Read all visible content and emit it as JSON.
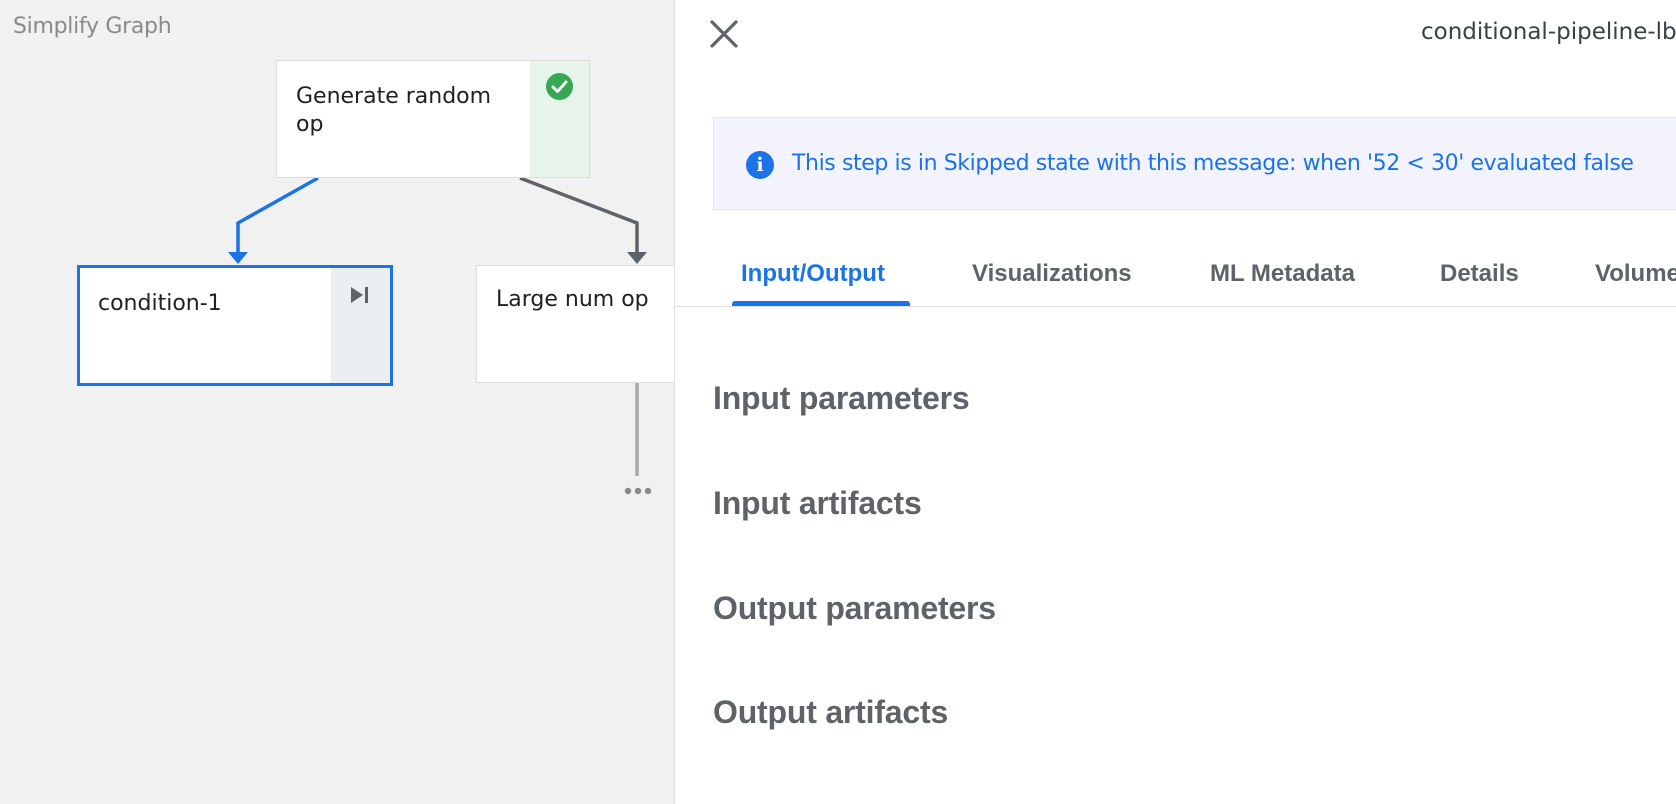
{
  "graph": {
    "simplify_label": "Simplify Graph",
    "nodes": {
      "generate": {
        "label": "Generate random op",
        "status": "succeeded"
      },
      "condition": {
        "label": "condition-1",
        "status": "skipped"
      },
      "large": {
        "label": "Large num op"
      }
    }
  },
  "panel": {
    "run_title": "conditional-pipeline-lbfk",
    "banner": {
      "icon": "info-icon",
      "message": "This step is in Skipped state with this message: when '52 < 30' evaluated false"
    },
    "tabs": [
      {
        "label": "Input/Output",
        "active": true
      },
      {
        "label": "Visualizations",
        "active": false
      },
      {
        "label": "ML Metadata",
        "active": false
      },
      {
        "label": "Details",
        "active": false
      },
      {
        "label": "Volume",
        "active": false
      }
    ],
    "sections": [
      {
        "label": "Input parameters"
      },
      {
        "label": "Input artifacts"
      },
      {
        "label": "Output parameters"
      },
      {
        "label": "Output artifacts"
      }
    ]
  },
  "colors": {
    "accent": "#1a73e8",
    "success": "#34a853",
    "edge": "#5f6368"
  }
}
